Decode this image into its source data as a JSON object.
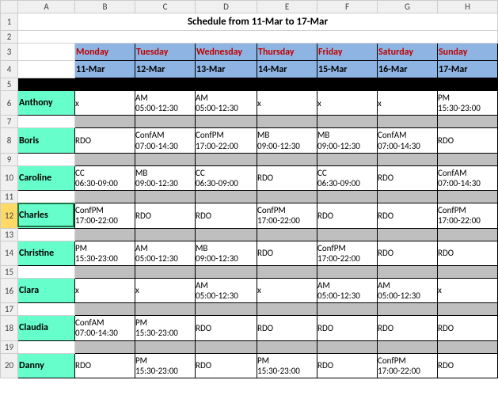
{
  "title": "Schedule from 11-Mar to 17-Mar",
  "col_letters": [
    "A",
    "B",
    "C",
    "D",
    "E",
    "F",
    "G",
    "H"
  ],
  "row_numbers": [
    "1",
    "2",
    "3",
    "4",
    "5",
    "6",
    "7",
    "8",
    "9",
    "10",
    "11",
    "12",
    "13",
    "14",
    "15",
    "16",
    "17",
    "18",
    "19",
    "20"
  ],
  "selected_row": "12",
  "days": [
    "Monday",
    "Tuesday",
    "Wednesday",
    "Thursday",
    "Friday",
    "Saturday",
    "Sunday"
  ],
  "dates": [
    "11-Mar",
    "12-Mar",
    "13-Mar",
    "14-Mar",
    "15-Mar",
    "16-Mar",
    "17-Mar"
  ],
  "people": [
    {
      "name": "Anthony",
      "cells": [
        {
          "l1": "x",
          "l2": ""
        },
        {
          "l1": "AM",
          "l2": "05:00-12:30"
        },
        {
          "l1": "AM",
          "l2": "05:00-12:30"
        },
        {
          "l1": "x",
          "l2": ""
        },
        {
          "l1": "x",
          "l2": ""
        },
        {
          "l1": "x",
          "l2": ""
        },
        {
          "l1": "PM",
          "l2": "15:30-23:00"
        }
      ]
    },
    {
      "name": "Boris",
      "cells": [
        {
          "l1": "RDO",
          "l2": ""
        },
        {
          "l1": "ConfAM",
          "l2": "07:00-14:30"
        },
        {
          "l1": "ConfPM",
          "l2": "17:00-22:00"
        },
        {
          "l1": "MB",
          "l2": "09:00-12:30"
        },
        {
          "l1": "MB",
          "l2": "09:00-12:30"
        },
        {
          "l1": "ConfAM",
          "l2": "07:00-14:30"
        },
        {
          "l1": "RDO",
          "l2": ""
        }
      ]
    },
    {
      "name": "Caroline",
      "cells": [
        {
          "l1": "CC",
          "l2": "06:30-09:00"
        },
        {
          "l1": "MB",
          "l2": "09:00-12:30"
        },
        {
          "l1": "CC",
          "l2": "06:30-09:00"
        },
        {
          "l1": "RDO",
          "l2": ""
        },
        {
          "l1": "CC",
          "l2": "06:30-09:00"
        },
        {
          "l1": "RDO",
          "l2": ""
        },
        {
          "l1": "ConfAM",
          "l2": "07:00-14:30"
        }
      ]
    },
    {
      "name": "Charles",
      "cells": [
        {
          "l1": "ConfPM",
          "l2": "17:00-22:00"
        },
        {
          "l1": "RDO",
          "l2": ""
        },
        {
          "l1": "RDO",
          "l2": ""
        },
        {
          "l1": "ConfPM",
          "l2": "17:00-22:00"
        },
        {
          "l1": "RDO",
          "l2": ""
        },
        {
          "l1": "RDO",
          "l2": ""
        },
        {
          "l1": "ConfPM",
          "l2": "17:00-22:00"
        }
      ]
    },
    {
      "name": "Christine",
      "cells": [
        {
          "l1": "PM",
          "l2": "15:30-23:00"
        },
        {
          "l1": "AM",
          "l2": "05:00-12:30"
        },
        {
          "l1": "MB",
          "l2": "09:00-12:30"
        },
        {
          "l1": "RDO",
          "l2": ""
        },
        {
          "l1": "ConfPM",
          "l2": "17:00-22:00"
        },
        {
          "l1": "RDO",
          "l2": ""
        },
        {
          "l1": "RDO",
          "l2": ""
        }
      ]
    },
    {
      "name": "Clara",
      "cells": [
        {
          "l1": "x",
          "l2": ""
        },
        {
          "l1": "x",
          "l2": ""
        },
        {
          "l1": "AM",
          "l2": "05:00-12:30"
        },
        {
          "l1": "x",
          "l2": ""
        },
        {
          "l1": "AM",
          "l2": "05:00-12:30"
        },
        {
          "l1": "AM",
          "l2": "05:00-12:30"
        },
        {
          "l1": "x",
          "l2": ""
        }
      ]
    },
    {
      "name": "Claudia",
      "cells": [
        {
          "l1": "ConfAM",
          "l2": "07:00-14:30"
        },
        {
          "l1": "PM",
          "l2": "15:30-23:00"
        },
        {
          "l1": "RDO",
          "l2": ""
        },
        {
          "l1": "RDO",
          "l2": ""
        },
        {
          "l1": "RDO",
          "l2": ""
        },
        {
          "l1": "RDO",
          "l2": ""
        },
        {
          "l1": "RDO",
          "l2": ""
        }
      ]
    },
    {
      "name": "Danny",
      "cells": [
        {
          "l1": "RDO",
          "l2": ""
        },
        {
          "l1": "PM",
          "l2": "15:30-23:00"
        },
        {
          "l1": "RDO",
          "l2": ""
        },
        {
          "l1": "PM",
          "l2": "15:30-23:00"
        },
        {
          "l1": "RDO",
          "l2": ""
        },
        {
          "l1": "ConfPM",
          "l2": "17:00-22:00"
        },
        {
          "l1": "RDO",
          "l2": ""
        }
      ]
    }
  ]
}
